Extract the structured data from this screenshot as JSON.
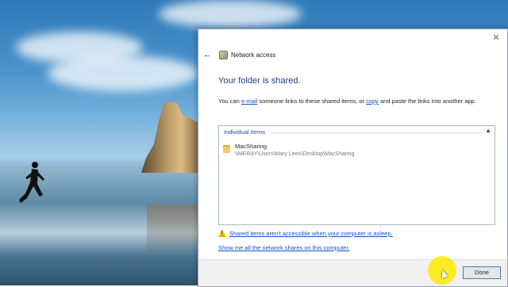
{
  "dialog": {
    "title": "Network access",
    "heading": "Your folder is shared.",
    "description": {
      "part1": "You can ",
      "email_link": "e-mail",
      "part2": " someone links to these shared items, or ",
      "copy_link": "copy",
      "part3": " and paste the links into another app."
    },
    "items_group": {
      "header": "Individual Items",
      "items": [
        {
          "name": "MacSharing",
          "path": "\\\\MERAY\\Users\\Mary Leen\\Desktop\\MacSharing"
        }
      ]
    },
    "warning_link": "Shared items aren't accessible when your computer is asleep.",
    "shares_link": "Show me all the network shares on this computer.",
    "done_label": "Done"
  },
  "icons": {
    "close": "close-icon",
    "back": "back-arrow-icon",
    "title": "network-sharing-icon",
    "folder": "folder-icon",
    "warning": "warning-icon",
    "collapse": "chevron-up-icon"
  }
}
